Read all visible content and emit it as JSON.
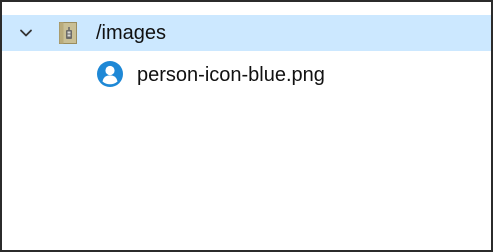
{
  "tree": {
    "folder": {
      "label": "/images",
      "expanded": true,
      "selected": true,
      "icon": "archive-folder-icon"
    },
    "files": [
      {
        "label": "person-icon-blue.png",
        "icon": "person-icon"
      }
    ]
  },
  "colors": {
    "selection_background": "#cce8ff",
    "accent": "#1e88d6",
    "text": "#111111"
  }
}
